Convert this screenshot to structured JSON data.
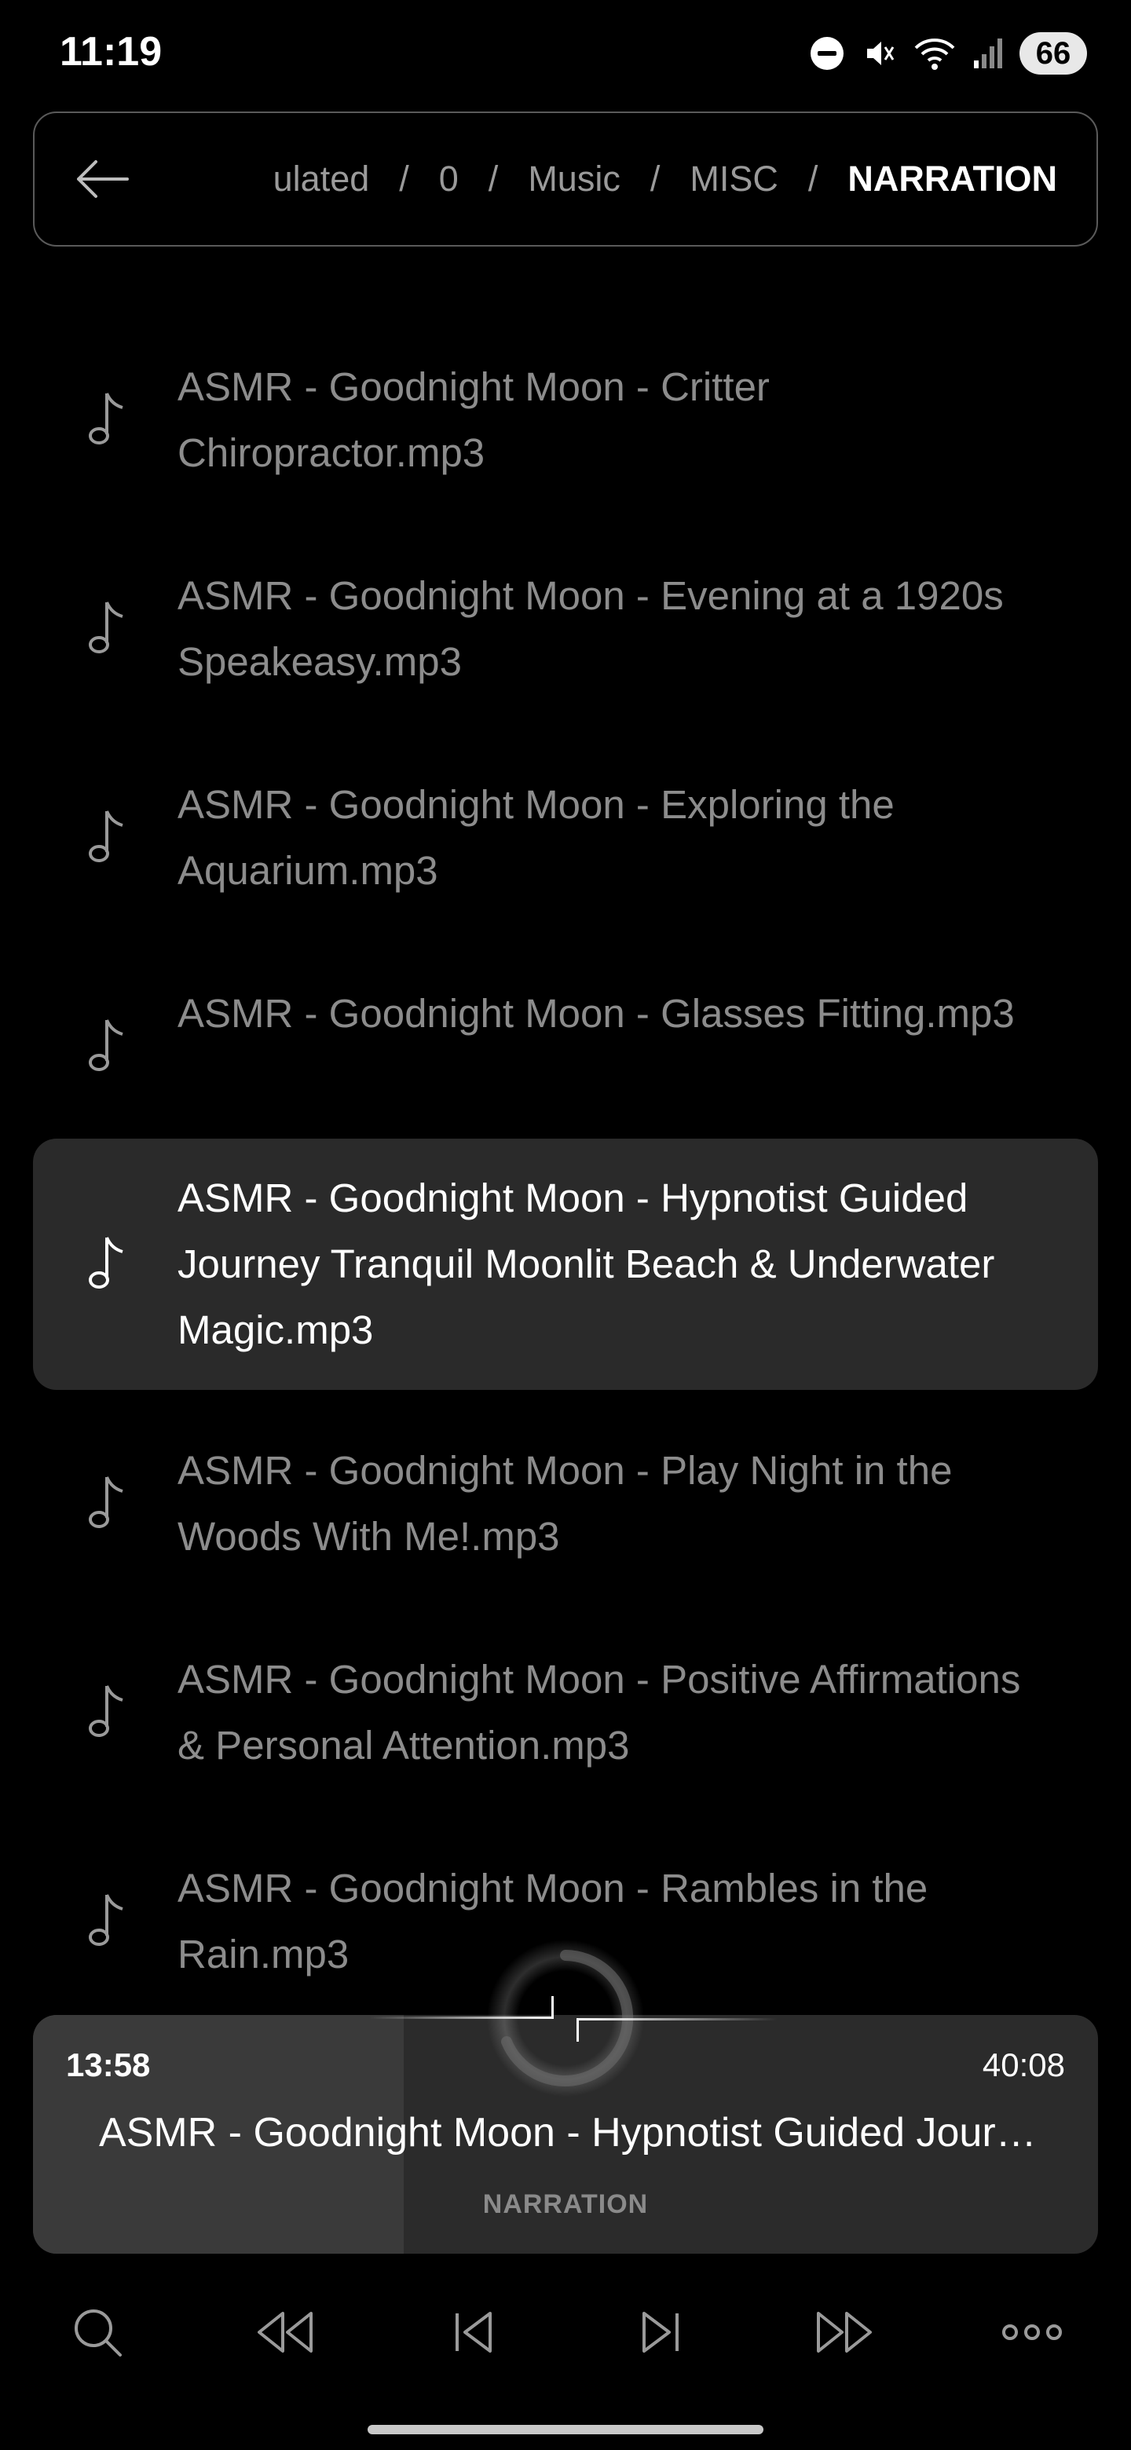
{
  "status_bar": {
    "time": "11:19",
    "battery": "66",
    "icons": [
      "dnd-icon",
      "mute-icon",
      "wifi-icon",
      "signal-icon",
      "battery-icon"
    ]
  },
  "breadcrumb": {
    "back_icon": "arrow-left-icon",
    "items": [
      "ulated",
      "0",
      "Music",
      "MISC",
      "NARRATION"
    ],
    "separator": "/"
  },
  "files": [
    {
      "name": "ASMR - Goodnight Moon - Critter Chiropractor.mp3",
      "icon": "music-note-icon",
      "selected": false
    },
    {
      "name": "ASMR - Goodnight Moon - Evening at a 1920s Speakeasy.mp3",
      "icon": "music-note-icon",
      "selected": false
    },
    {
      "name": "ASMR - Goodnight Moon - Exploring the Aquarium.mp3",
      "icon": "music-note-icon",
      "selected": false
    },
    {
      "name": "ASMR - Goodnight Moon - Glasses Fitting.mp3",
      "icon": "music-note-icon",
      "selected": false
    },
    {
      "name": "ASMR - Goodnight Moon - Hypnotist Guided Journey Tranquil Moonlit Beach & Underwater Magic.mp3",
      "icon": "music-note-icon",
      "selected": true
    },
    {
      "name": "ASMR - Goodnight Moon - Play Night in the Woods With Me!.mp3",
      "icon": "music-note-icon",
      "selected": false
    },
    {
      "name": "ASMR - Goodnight Moon - Positive Affirmations & Personal Attention.mp3",
      "icon": "music-note-icon",
      "selected": false
    },
    {
      "name": "ASMR - Goodnight Moon - Rambles in the Rain.mp3",
      "icon": "music-note-icon",
      "selected": false
    }
  ],
  "player": {
    "elapsed": "13:58",
    "total": "40:08",
    "title": "ASMR - Goodnight Moon - Hypnotist Guided Journey Tranquil Moonlit Beach & Underwater Magic.mp3",
    "folder": "NARRATION",
    "progress": 0.348
  },
  "controls": [
    "search-icon",
    "fast-rewind-icon",
    "previous-track-icon",
    "next-track-icon",
    "fast-forward-icon",
    "more-icon"
  ],
  "colors": {
    "background": "#000000",
    "selected_row": "#2a2a2a",
    "dim_text": "#8c8c8c",
    "player_bg": "#2b2b2b"
  }
}
